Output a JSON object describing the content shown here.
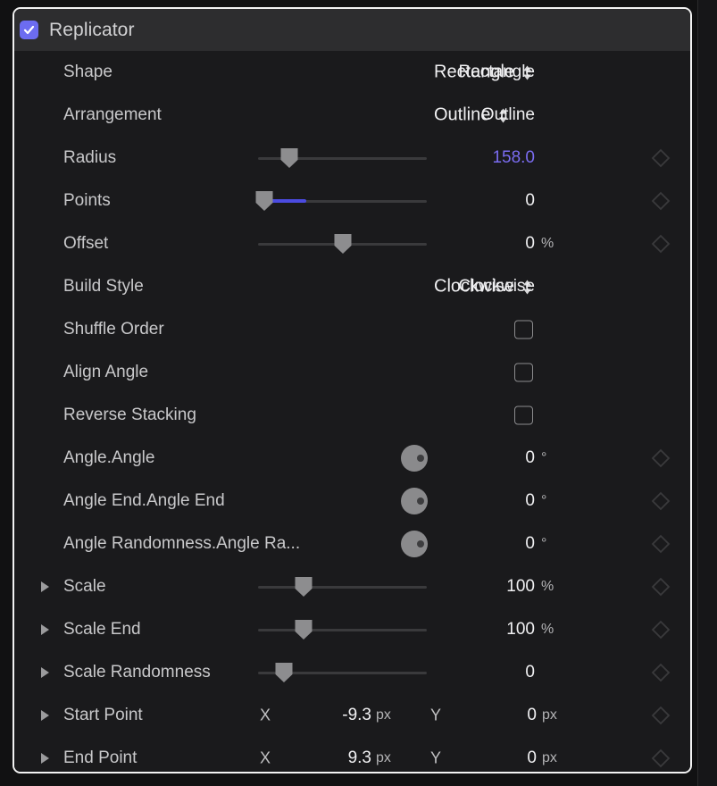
{
  "panel": {
    "title": "Replicator",
    "enabled_checkbox": true,
    "accent_color": "#6c6cf0",
    "value_accent_color": "#7a6cf0"
  },
  "rows": [
    {
      "name": "shape",
      "label": "Shape",
      "control": "popup",
      "value": "Rectangle",
      "keyframe": false
    },
    {
      "name": "arrangement",
      "label": "Arrangement",
      "control": "popup",
      "value": "Outline",
      "keyframe": false
    },
    {
      "name": "radius",
      "label": "Radius",
      "control": "slider",
      "value": "158.0",
      "unit": "",
      "accent": true,
      "keyframe": true
    },
    {
      "name": "points",
      "label": "Points",
      "control": "slider",
      "value": "0",
      "unit": "",
      "accent": false,
      "keyframe": true
    },
    {
      "name": "offset",
      "label": "Offset",
      "control": "slider",
      "value": "0",
      "unit": "%",
      "accent": false,
      "keyframe": true
    },
    {
      "name": "build-style",
      "label": "Build Style",
      "control": "popup",
      "value": "Clockwise",
      "keyframe": false
    },
    {
      "name": "shuffle-order",
      "label": "Shuffle Order",
      "control": "checkbox",
      "checked": false,
      "keyframe": false
    },
    {
      "name": "align-angle",
      "label": "Align Angle",
      "control": "checkbox",
      "checked": false,
      "keyframe": false
    },
    {
      "name": "reverse-stacking",
      "label": "Reverse Stacking",
      "control": "checkbox",
      "checked": false,
      "keyframe": false
    },
    {
      "name": "angle-angle",
      "label": "Angle.Angle",
      "control": "knob",
      "value": "0",
      "unit": "°",
      "keyframe": true
    },
    {
      "name": "angle-end",
      "label": "Angle End.Angle End",
      "control": "knob",
      "value": "0",
      "unit": "°",
      "keyframe": true
    },
    {
      "name": "angle-randomness",
      "label": "Angle Randomness.Angle Ra...",
      "control": "knob",
      "value": "0",
      "unit": "°",
      "keyframe": true
    },
    {
      "name": "scale",
      "label": "Scale",
      "control": "slider",
      "value": "100",
      "unit": "%",
      "disclosure": true,
      "keyframe": true
    },
    {
      "name": "scale-end",
      "label": "Scale End",
      "control": "slider",
      "value": "100",
      "unit": "%",
      "disclosure": true,
      "keyframe": true
    },
    {
      "name": "scale-randomness",
      "label": "Scale Randomness",
      "control": "slider",
      "value": "0",
      "unit": "",
      "disclosure": true,
      "keyframe": true
    },
    {
      "name": "start-point",
      "label": "Start Point",
      "control": "point",
      "x_axis_label": "X",
      "x_value": "-9.3",
      "x_unit": "px",
      "y_axis_label": "Y",
      "y_value": "0",
      "y_unit": "px",
      "disclosure": true,
      "keyframe": true
    },
    {
      "name": "end-point",
      "label": "End Point",
      "control": "point",
      "x_axis_label": "X",
      "x_value": "9.3",
      "x_unit": "px",
      "y_axis_label": "Y",
      "y_value": "0",
      "y_unit": "px",
      "disclosure": true,
      "keyframe": true
    }
  ]
}
